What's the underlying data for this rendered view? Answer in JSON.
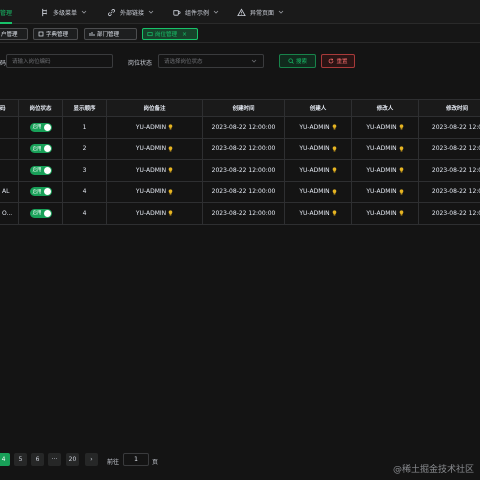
{
  "topnav": {
    "items": [
      {
        "label": "管理",
        "icon": "settings-icon",
        "active": true
      },
      {
        "label": "多级菜单",
        "icon": "tree-icon",
        "active": false
      },
      {
        "label": "外部链接",
        "icon": "link-icon",
        "active": false
      },
      {
        "label": "组件示例",
        "icon": "cup-icon",
        "active": false
      },
      {
        "label": "异常页面",
        "icon": "warning-icon",
        "active": false
      }
    ]
  },
  "tags": [
    {
      "label": "户管理",
      "active": false
    },
    {
      "label": "字典管理",
      "active": false
    },
    {
      "label": "部门管理",
      "active": false
    },
    {
      "label": "岗位管理",
      "active": true,
      "close": "×"
    }
  ],
  "search": {
    "code_label": "码",
    "code_placeholder": "请输入岗位编码",
    "status_label": "岗位状态",
    "status_placeholder": "请选择岗位状态",
    "search_button": "搜索",
    "reset_button": "重置"
  },
  "table": {
    "headers": [
      "码",
      "岗位状态",
      "显示顺序",
      "岗位备注",
      "创建时间",
      "创建人",
      "修改人",
      "修改时间"
    ],
    "rows": [
      {
        "code": "",
        "status": "启用",
        "order": "1",
        "remark": "YU-ADMIN",
        "created": "2023-08-22 12:00:00",
        "creator": "YU-ADMIN",
        "modifier": "YU-ADMIN",
        "modified": "2023-08-22 12:0"
      },
      {
        "code": "",
        "status": "启用",
        "order": "2",
        "remark": "YU-ADMIN",
        "created": "2023-08-22 12:00:00",
        "creator": "YU-ADMIN",
        "modifier": "YU-ADMIN",
        "modified": "2023-08-22 12:0"
      },
      {
        "code": "",
        "status": "启用",
        "order": "3",
        "remark": "YU-ADMIN",
        "created": "2023-08-22 12:00:00",
        "creator": "YU-ADMIN",
        "modifier": "YU-ADMIN",
        "modified": "2023-08-22 12:0"
      },
      {
        "code": "AL",
        "status": "启用",
        "order": "4",
        "remark": "YU-ADMIN",
        "created": "2023-08-22 12:00:00",
        "creator": "YU-ADMIN",
        "modifier": "YU-ADMIN",
        "modified": "2023-08-22 12:0"
      },
      {
        "code": "O...",
        "status": "启用",
        "order": "4",
        "remark": "YU-ADMIN",
        "created": "2023-08-22 12:00:00",
        "creator": "YU-ADMIN",
        "modifier": "YU-ADMIN",
        "modified": "2023-08-22 12:0"
      }
    ]
  },
  "pagination": {
    "pages": [
      "4",
      "5",
      "6",
      "···",
      "20"
    ],
    "active_page": "4",
    "next": "›",
    "goto_label": "前往",
    "goto_value": "1",
    "page_unit": "页"
  },
  "watermark": "@稀土掘金技术社区",
  "colors": {
    "accent": "#18c26a",
    "danger": "#f06a6a",
    "background": "#141414"
  }
}
